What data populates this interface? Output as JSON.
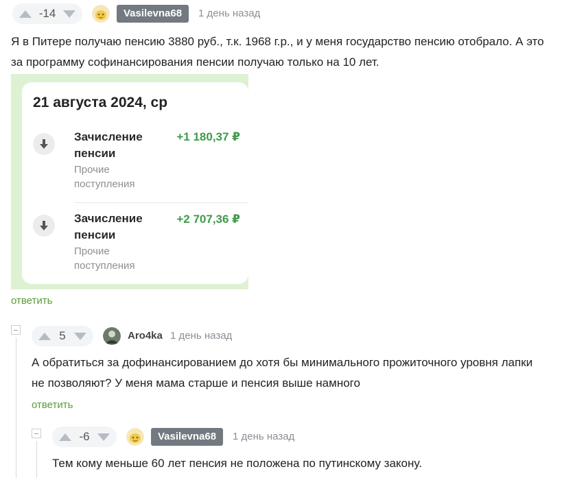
{
  "comment1": {
    "score": "-14",
    "author": "Vasilevna68",
    "time": "1 день назад",
    "text_line1": "Я в Питере получаю пенсию 3880 руб., т.к. 1968 г.р., и у меня государство пенсию отобрало. А это",
    "text_line2": "за программу софинансирования пенсии получаю только на 10 лет.",
    "reply": "ответить",
    "attachment": {
      "date": "21 августа 2024, ср",
      "operations": [
        {
          "title": "Зачисление пенсии",
          "category": "Прочие поступления",
          "amount": "+1 180,37 ₽"
        },
        {
          "title": "Зачисление пенсии",
          "category": "Прочие поступления",
          "amount": "+2 707,36 ₽"
        }
      ]
    }
  },
  "comment2": {
    "score": "5",
    "author": "Aro4ka",
    "time": "1 день назад",
    "text_line1": "А обратиться за дофинансированием до хотя бы минимального прожиточного уровня лапки",
    "text_line2": "не позволяют? У меня мама старше и пенсия выше намного",
    "reply": "ответить"
  },
  "comment3": {
    "score": "-6",
    "author": "Vasilevna68",
    "time": "1 день назад",
    "text_line1": "Тем кому меньше 60 лет пенсия не положена по путинскому закону."
  },
  "colors": {
    "reply_link": "#5a9a3a",
    "amount_green": "#3e9b4a",
    "badge_bg": "#727980"
  },
  "icons": [
    "upvote-icon",
    "downvote-icon",
    "collapse-icon",
    "incoming-arrow-icon"
  ]
}
